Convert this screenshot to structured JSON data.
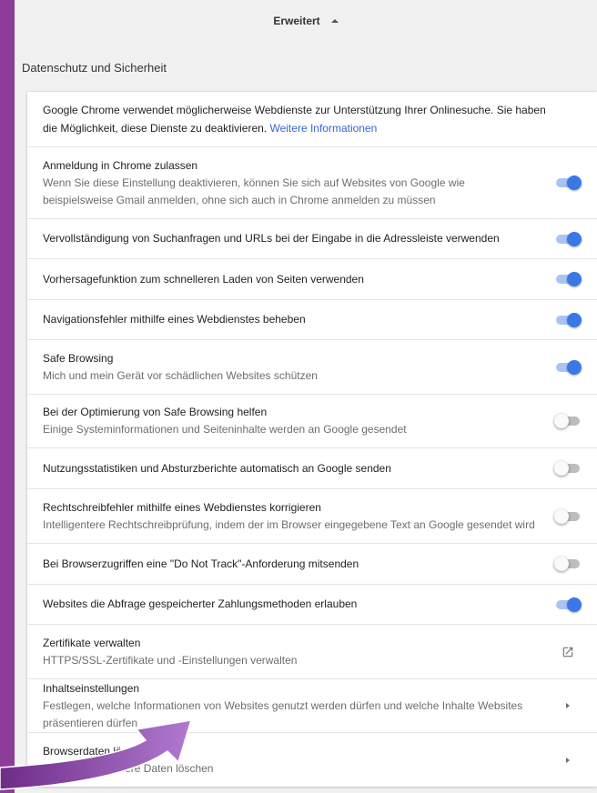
{
  "header": {
    "advanced_label": "Erweitert"
  },
  "section": {
    "title": "Datenschutz und Sicherheit"
  },
  "intro": {
    "text": "Google Chrome verwendet möglicherweise Webdienste zur Unterstützung Ihrer Onlinesuche. Sie haben die Möglichkeit, diese Dienste zu deaktivieren.",
    "link": "Weitere Informationen"
  },
  "settings": [
    {
      "primary": "Anmeldung in Chrome zulassen",
      "secondary": "Wenn Sie diese Einstellung deaktivieren, können Sie sich auf Websites von Google wie beispielsweise Gmail anmelden, ohne sich auch in Chrome anmelden zu müssen",
      "state": "on"
    },
    {
      "primary": "Vervollständigung von Suchanfragen und URLs bei der Eingabe in die Adressleiste verwenden",
      "state": "on"
    },
    {
      "primary": "Vorhersagefunktion zum schnelleren Laden von Seiten verwenden",
      "state": "on"
    },
    {
      "primary": "Navigationsfehler mithilfe eines Webdienstes beheben",
      "state": "on"
    },
    {
      "primary": "Safe Browsing",
      "secondary": "Mich und mein Gerät vor schädlichen Websites schützen",
      "state": "on"
    },
    {
      "primary": "Bei der Optimierung von Safe Browsing helfen",
      "secondary": "Einige Systeminformationen und Seiteninhalte werden an Google gesendet",
      "state": "off"
    },
    {
      "primary": "Nutzungsstatistiken und Absturzberichte automatisch an Google senden",
      "state": "off"
    },
    {
      "primary": "Rechtschreibfehler mithilfe eines Webdienstes korrigieren",
      "secondary": "Intelligentere Rechtschreibprüfung, indem der im Browser eingegebene Text an Google gesendet wird",
      "state": "off"
    },
    {
      "primary": "Bei Browserzugriffen eine \"Do Not Track\"-Anforderung mitsenden",
      "state": "off"
    },
    {
      "primary": "Websites die Abfrage gespeicherter Zahlungsmethoden erlauben",
      "state": "on"
    },
    {
      "primary": "Zertifikate verwalten",
      "secondary": "HTTPS/SSL-Zertifikate und -Einstellungen verwalten",
      "icon": "external-link-icon"
    },
    {
      "primary": "Inhaltseinstellungen",
      "secondary": "Festlegen, welche Informationen von Websites genutzt werden dürfen und welche Inhalte Websites präsentieren dürfen",
      "icon": "chevron-right-icon"
    },
    {
      "primary": "Browserdaten löschen",
      "secondary": "Cookies und andere Daten löschen",
      "icon": "chevron-right-icon"
    }
  ],
  "colors": {
    "frame": "#8e3c9a",
    "toggle_on": "#3b78e7",
    "link": "#3367d6",
    "overlay_arrow": "#9b5cc4"
  }
}
